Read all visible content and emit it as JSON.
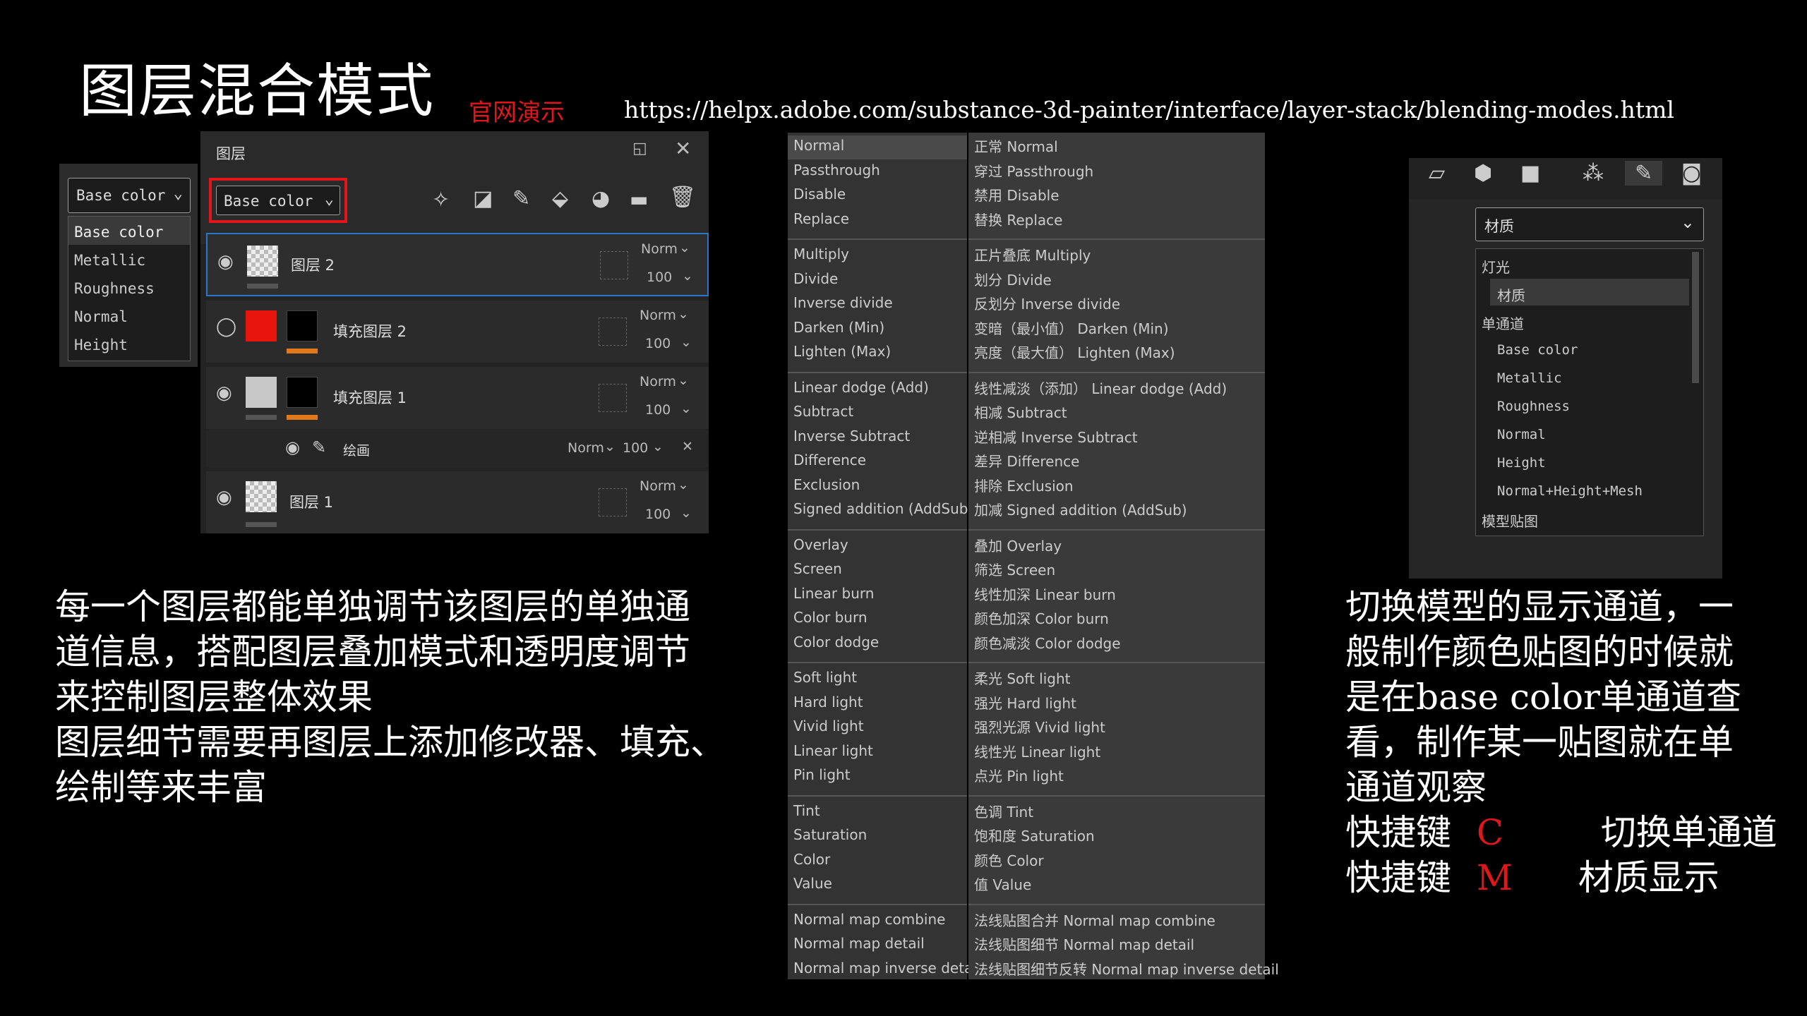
{
  "header": {
    "title": "图层混合模式",
    "demo_label": "官网演示",
    "url": "https://helpx.adobe.com/substance-3d-painter/interface/layer-stack/blending-modes.html"
  },
  "channel_dropdown": {
    "selected": "Base color",
    "options": [
      "Base color",
      "Metallic",
      "Roughness",
      "Normal",
      "Height"
    ]
  },
  "layers_panel": {
    "title": "图层",
    "channel_selected": "Base color",
    "layers": [
      {
        "name": "图层 2",
        "blend": "Norm",
        "opacity": "100"
      },
      {
        "name": "填充图层 2",
        "blend": "Norm",
        "opacity": "100"
      },
      {
        "name": "填充图层 1",
        "blend": "Norm",
        "opacity": "100"
      },
      {
        "name": "绘画",
        "blend": "Norm",
        "opacity": "100"
      },
      {
        "name": "图层 1",
        "blend": "Norm",
        "opacity": "100"
      }
    ]
  },
  "blend_menu": {
    "english": [
      "Normal",
      "Passthrough",
      "Disable",
      "Replace",
      "Multiply",
      "Divide",
      "Inverse divide",
      "Darken (Min)",
      "Lighten (Max)",
      "Linear dodge (Add)",
      "Subtract",
      "Inverse Subtract",
      "Difference",
      "Exclusion",
      "Signed addition (AddSub)",
      "Overlay",
      "Screen",
      "Linear burn",
      "Color burn",
      "Color dodge",
      "Soft light",
      "Hard light",
      "Vivid light",
      "Linear light",
      "Pin light",
      "Tint",
      "Saturation",
      "Color",
      "Value",
      "Normal map combine",
      "Normal map detail",
      "Normal map inverse detail"
    ],
    "chinese": [
      "正常 Normal",
      "穿过 Passthrough",
      "禁用 Disable",
      "替换 Replace",
      "正片叠底 Multiply",
      "划分 Divide",
      "反划分 Inverse divide",
      "变暗（最小值） Darken (Min)",
      "亮度（最大值） Lighten (Max)",
      "线性减淡（添加） Linear dodge (Add)",
      "相减 Subtract",
      "逆相减 Inverse Subtract",
      "差异 Difference",
      "排除 Exclusion",
      "加减 Signed addition (AddSub)",
      "叠加 Overlay",
      "筛选 Screen",
      "线性加深 Linear burn",
      "颜色加深 Color burn",
      "颜色减淡 Color dodge",
      "柔光 Soft light",
      "强光 Hard light",
      "强烈光源 Vivid light",
      "线性光 Linear light",
      "点光 Pin light",
      "色调 Tint",
      "饱和度 Saturation",
      "颜色 Color",
      "值 Value",
      "法线贴图合并 Normal map combine",
      "法线贴图细节 Normal map detail",
      "法线贴图细节反转 Normal map inverse detail"
    ]
  },
  "viewport_panel": {
    "selected": "材质",
    "list": [
      "灯光",
      "材质",
      "单通道",
      "Base color",
      "Metallic",
      "Roughness",
      "Normal",
      "Height",
      "Normal+Height+Mesh",
      "模型贴图"
    ]
  },
  "left_text": [
    "每一个图层都能单独调节该图层的单独通",
    "道信息，搭配图层叠加模式和透明度调节",
    "来控制图层整体效果",
    "图层细节需要再图层上添加修改器、填充、",
    "绘制等来丰富"
  ],
  "right_text": [
    "切换模型的显示通道，一",
    "般制作颜色贴图的时候就",
    "是在base color单通道查",
    "看，制作某一贴图就在单",
    "通道观察"
  ],
  "shortcuts": [
    {
      "label": "快捷键",
      "key": "C",
      "desc": "切换单通道"
    },
    {
      "label": "快捷键",
      "key": "M",
      "desc": "材质显示"
    }
  ],
  "colors": {
    "accent_red": "#e0161b",
    "highlight_blue": "#2c76c9",
    "orange": "#e07a1a"
  }
}
